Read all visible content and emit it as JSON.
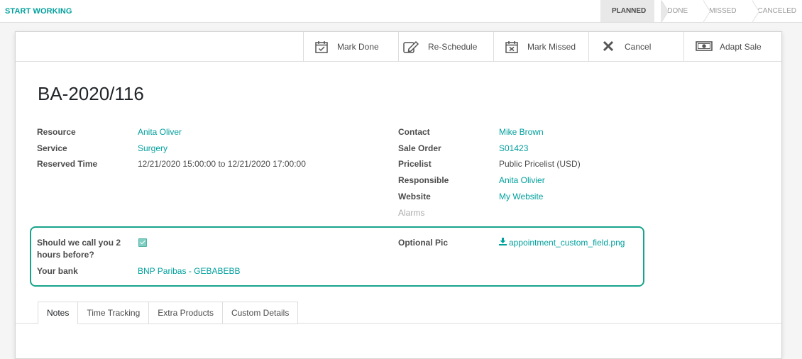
{
  "topbar": {
    "start_label": "START WORKING",
    "stages": [
      "PLANNED",
      "DONE",
      "MISSED",
      "CANCELED"
    ],
    "active_stage": "PLANNED"
  },
  "actions": {
    "mark_done": "Mark Done",
    "reschedule": "Re-Schedule",
    "mark_missed": "Mark Missed",
    "cancel": "Cancel",
    "adapt_sale": "Adapt Sale"
  },
  "record": {
    "title": "BA-2020/116",
    "left": {
      "resource_label": "Resource",
      "resource_value": "Anita Oliver",
      "service_label": "Service",
      "service_value": "Surgery",
      "reserved_label": "Reserved Time",
      "reserved_value": "12/21/2020 15:00:00 to 12/21/2020 17:00:00"
    },
    "right": {
      "contact_label": "Contact",
      "contact_value": "Mike Brown",
      "sale_order_label": "Sale Order",
      "sale_order_value": "S01423",
      "pricelist_label": "Pricelist",
      "pricelist_value": "Public Pricelist (USD)",
      "responsible_label": "Responsible",
      "responsible_value": "Anita Olivier",
      "website_label": "Website",
      "website_value": "My Website",
      "alarms_label": "Alarms"
    },
    "custom": {
      "call_label_1": "Should we call you 2",
      "call_label_2": "hours before?",
      "call_checked": true,
      "bank_label": "Your bank",
      "bank_value": "BNP Paribas - GEBABEBB",
      "pic_label": "Optional Pic",
      "pic_value": "appointment_custom_field.png"
    }
  },
  "tabs": [
    "Notes",
    "Time Tracking",
    "Extra Products",
    "Custom Details"
  ],
  "colors": {
    "accent": "#00A09D",
    "highlight": "#18a38b"
  }
}
